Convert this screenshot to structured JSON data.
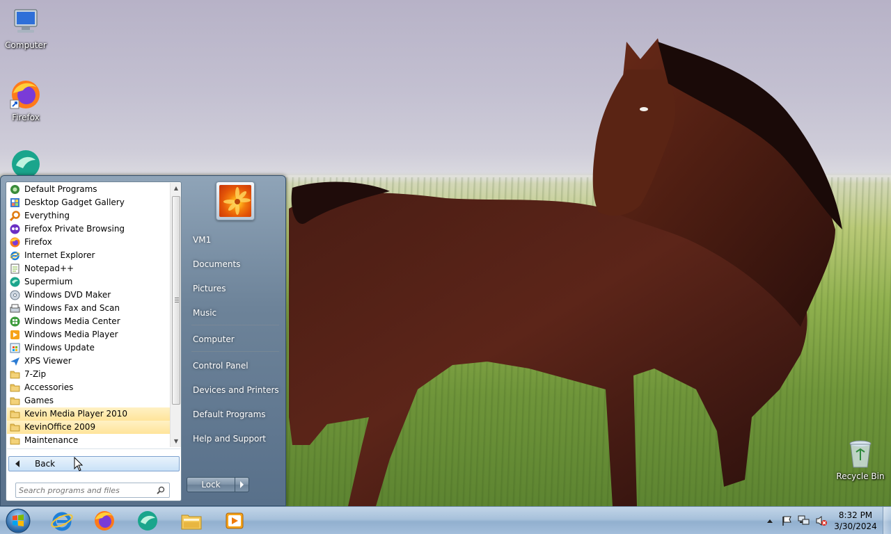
{
  "desktop": {
    "icons": [
      {
        "label": "Computer",
        "icon": "computer-icon"
      },
      {
        "label": "Firefox",
        "icon": "firefox-icon"
      },
      {
        "label": "",
        "icon": "supermium-icon"
      },
      {
        "label": "Recycle Bin",
        "icon": "recycle-bin-icon"
      }
    ]
  },
  "start_menu": {
    "programs": [
      {
        "label": "Default Programs",
        "icon": "default-programs-icon",
        "highlighted": false
      },
      {
        "label": "Desktop Gadget Gallery",
        "icon": "gadget-gallery-icon",
        "highlighted": false
      },
      {
        "label": "Everything",
        "icon": "everything-search-icon",
        "highlighted": false
      },
      {
        "label": "Firefox Private Browsing",
        "icon": "firefox-private-icon",
        "highlighted": false
      },
      {
        "label": "Firefox",
        "icon": "firefox-icon",
        "highlighted": false
      },
      {
        "label": "Internet Explorer",
        "icon": "internet-explorer-icon",
        "highlighted": false
      },
      {
        "label": "Notepad++",
        "icon": "notepadpp-icon",
        "highlighted": false
      },
      {
        "label": "Supermium",
        "icon": "supermium-icon",
        "highlighted": false
      },
      {
        "label": "Windows DVD Maker",
        "icon": "dvd-maker-icon",
        "highlighted": false
      },
      {
        "label": "Windows Fax and Scan",
        "icon": "fax-scan-icon",
        "highlighted": false
      },
      {
        "label": "Windows Media Center",
        "icon": "media-center-icon",
        "highlighted": false
      },
      {
        "label": "Windows Media Player",
        "icon": "media-player-icon",
        "highlighted": false
      },
      {
        "label": "Windows Update",
        "icon": "windows-update-icon",
        "highlighted": false
      },
      {
        "label": "XPS Viewer",
        "icon": "xps-viewer-icon",
        "highlighted": false
      },
      {
        "label": "7-Zip",
        "icon": "folder-icon",
        "highlighted": false
      },
      {
        "label": "Accessories",
        "icon": "folder-icon",
        "highlighted": false
      },
      {
        "label": "Games",
        "icon": "folder-icon",
        "highlighted": false
      },
      {
        "label": "Kevin Media Player 2010",
        "icon": "folder-icon",
        "highlighted": true
      },
      {
        "label": "KevinOffice 2009",
        "icon": "folder-icon",
        "highlighted": true
      },
      {
        "label": "Maintenance",
        "icon": "folder-icon",
        "highlighted": false
      }
    ],
    "back_label": "Back",
    "search_placeholder": "Search programs and files",
    "right_items": [
      {
        "label": "VM1"
      },
      {
        "label": "Documents"
      },
      {
        "label": "Pictures"
      },
      {
        "label": "Music"
      },
      {
        "label": "Computer"
      },
      {
        "label": "Control Panel"
      },
      {
        "label": "Devices and Printers"
      },
      {
        "label": "Default Programs"
      },
      {
        "label": "Help and Support"
      }
    ],
    "lock_label": "Lock"
  },
  "taskbar": {
    "pinned": [
      {
        "icon": "internet-explorer-icon"
      },
      {
        "icon": "firefox-icon"
      },
      {
        "icon": "supermium-icon"
      },
      {
        "icon": "file-explorer-icon"
      },
      {
        "icon": "media-player-icon"
      }
    ],
    "tray_icons": [
      "show-hidden-icons-chevron-icon",
      "action-center-flag-icon",
      "network-icon",
      "volume-muted-icon"
    ],
    "clock_time": "8:32 PM",
    "clock_date": "3/30/2024"
  },
  "colors": {
    "highlight": "#ffe49a",
    "start_menu_glass": "#6d8399",
    "taskbar": "#a7c1db"
  }
}
